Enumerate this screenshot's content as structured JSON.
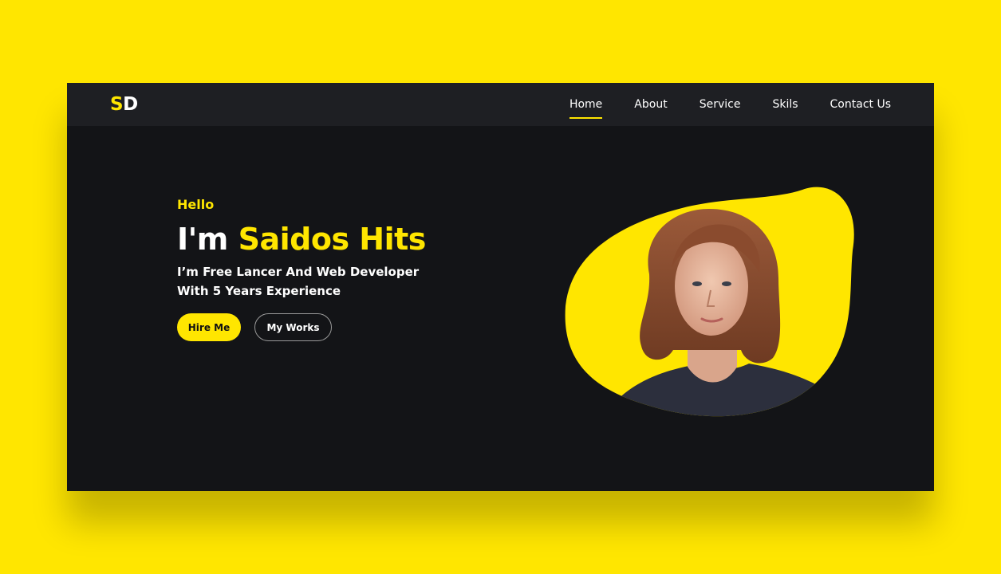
{
  "brand": {
    "logo_first": "S",
    "logo_second": "D"
  },
  "nav": {
    "items": [
      {
        "label": "Home",
        "active": true
      },
      {
        "label": "About",
        "active": false
      },
      {
        "label": "Service",
        "active": false
      },
      {
        "label": "Skils",
        "active": false
      },
      {
        "label": "Contact Us",
        "active": false
      }
    ]
  },
  "hero": {
    "greeting": "Hello",
    "headline_prefix": "I'm ",
    "headline_name": "Saidos Hits",
    "subtitle_line1": "I’m Free Lancer And Web Developer",
    "subtitle_line2": "With 5 Years Experience",
    "primary_button": "Hire Me",
    "secondary_button": "My Works"
  },
  "colors": {
    "accent": "#FFE600",
    "background": "#131417",
    "navbar": "#1e1f23",
    "text": "#ffffff"
  },
  "icons": {
    "portrait": "profile-photo-icon"
  }
}
